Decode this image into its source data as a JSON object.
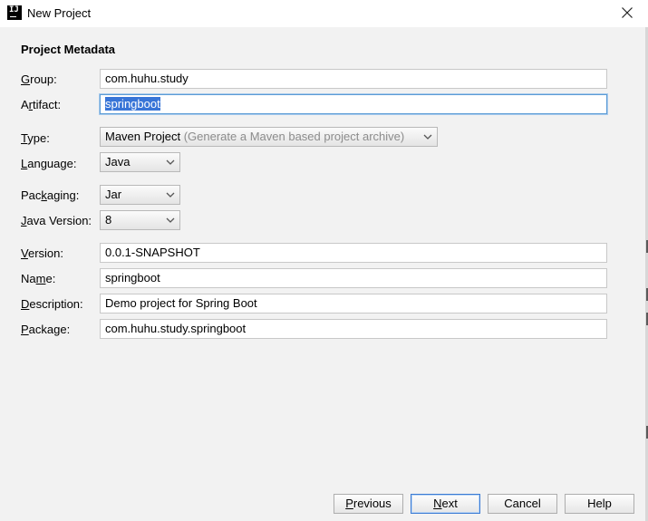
{
  "window": {
    "title": "New Project",
    "app_icon_text": "IJ"
  },
  "section": {
    "heading": "Project Metadata"
  },
  "form": {
    "group": {
      "label_mn": "G",
      "label_rest": "roup:",
      "value": "com.huhu.study"
    },
    "artifact": {
      "label_pre": "A",
      "label_mn": "r",
      "label_rest": "tifact:",
      "value": "springboot"
    },
    "type": {
      "label_mn": "T",
      "label_rest": "ype:",
      "value": "Maven Project",
      "hint": "(Generate a Maven based project archive)"
    },
    "language": {
      "label_mn": "L",
      "label_rest": "anguage:",
      "value": "Java"
    },
    "packaging": {
      "label_pre": "Pac",
      "label_mn": "k",
      "label_rest": "aging:",
      "value": "Jar"
    },
    "java_version": {
      "label_mn": "J",
      "label_rest": "ava Version:",
      "value": "8"
    },
    "version": {
      "label_mn": "V",
      "label_rest": "ersion:",
      "value": "0.0.1-SNAPSHOT"
    },
    "name": {
      "label_pre": "Na",
      "label_mn": "m",
      "label_rest": "e:",
      "value": "springboot"
    },
    "description": {
      "label_mn": "D",
      "label_rest": "escription:",
      "value": "Demo project for Spring Boot"
    },
    "package": {
      "label_mn": "P",
      "label_rest": "ackage:",
      "value": "com.huhu.study.springboot"
    }
  },
  "buttons": {
    "previous": {
      "mn": "P",
      "rest": "revious"
    },
    "next": {
      "mn": "N",
      "rest": "ext"
    },
    "cancel": "Cancel",
    "help": "Help"
  },
  "colors": {
    "focus_border": "#5b9bd5",
    "selection": "#3875d7",
    "panel_bg": "#f2f2f2"
  }
}
